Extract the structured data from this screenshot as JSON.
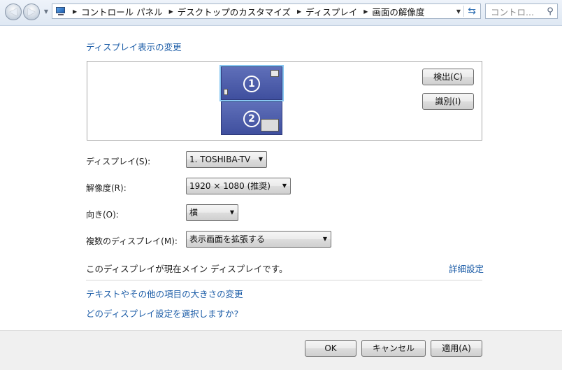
{
  "address_bar": {
    "breadcrumbs": [
      "コントロール パネル",
      "デスクトップのカスタマイズ",
      "ディスプレイ",
      "画面の解像度"
    ]
  },
  "search": {
    "placeholder": "コントロ..."
  },
  "page": {
    "title": "ディスプレイ表示の変更",
    "monitors": [
      {
        "number": "1",
        "selected": true
      },
      {
        "number": "2",
        "selected": false
      }
    ],
    "detect_button": "検出(C)",
    "identify_button": "識別(I)",
    "display_label": "ディスプレイ(S):",
    "display_value": "1. TOSHIBA-TV",
    "resolution_label": "解像度(R):",
    "resolution_value": "1920 × 1080 (推奨)",
    "orientation_label": "向き(O):",
    "orientation_value": "横",
    "multi_label": "複数のディスプレイ(M):",
    "multi_value": "表示画面を拡張する",
    "main_display_text": "このディスプレイが現在メイン ディスプレイです。",
    "advanced_link": "詳細設定",
    "text_size_link": "テキストやその他の項目の大きさの変更",
    "which_settings_link": "どのディスプレイ設定を選択しますか?"
  },
  "footer": {
    "ok": "OK",
    "cancel": "キャンセル",
    "apply": "適用(A)"
  },
  "colors": {
    "link": "#1e5ea8",
    "monitor": "#4b5aa8",
    "selection": "#88c7f2"
  },
  "icons": [
    "back-arrow-icon",
    "forward-arrow-icon",
    "computer-icon",
    "refresh-icon",
    "search-icon"
  ]
}
